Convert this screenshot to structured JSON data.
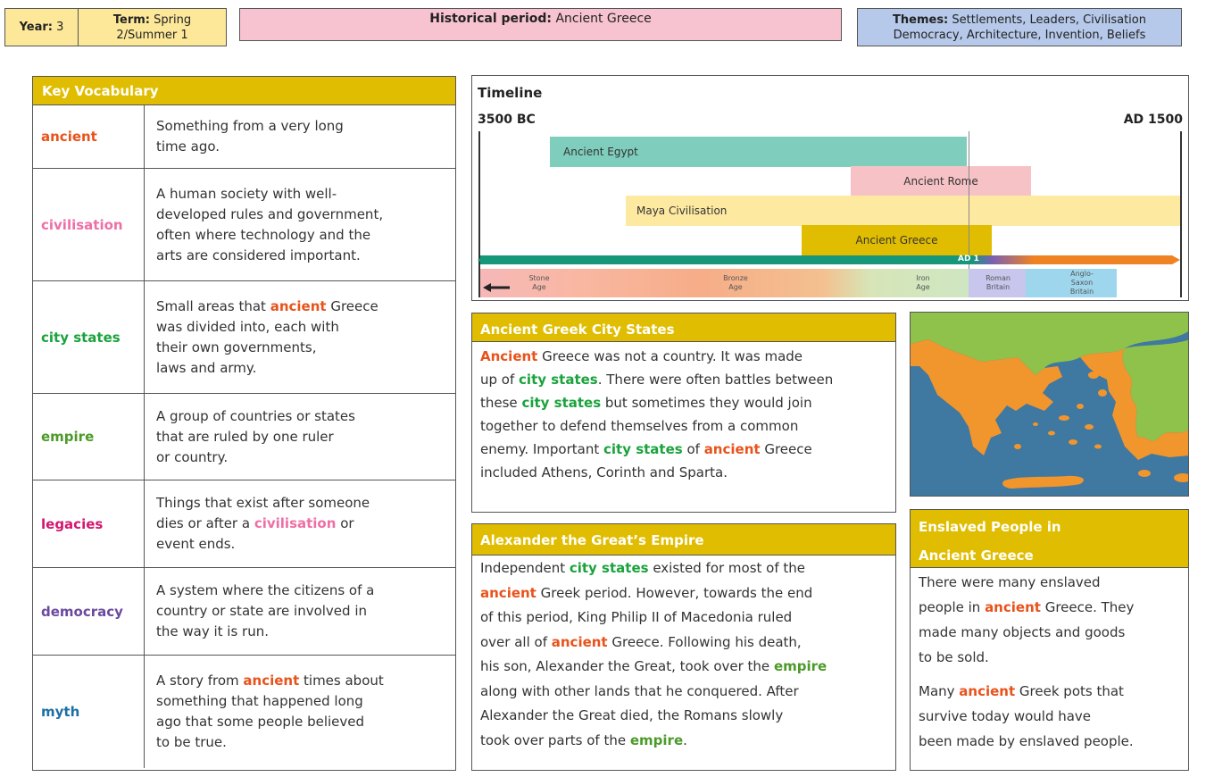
{
  "header": {
    "year_label": "Year:",
    "year_value": "3",
    "term_label": "Term:",
    "term_value_1": "Spring",
    "term_value_2": "2/Summer 1",
    "period_label": "Historical period:",
    "period_value": "Ancient Greece",
    "themes_label": "Themes:",
    "themes_line1": "Settlements, Leaders, Civilisation",
    "themes_line2": "Democracy, Architecture, Invention, Beliefs"
  },
  "vocab": {
    "title": "Key Vocabulary",
    "rows": [
      {
        "term": "ancient",
        "def": [
          "Something from a very long",
          "time ago."
        ]
      },
      {
        "term": "civilisation",
        "def": [
          "A human society with well-",
          "developed rules and government,",
          "often where technology and the",
          "arts are considered important."
        ]
      },
      {
        "term": "city states",
        "def_pre": "Small areas that ",
        "def_hl": "ancient",
        "def_post": " Greece",
        "def": [
          "was divided into, each with",
          "their own governments,",
          "laws and army."
        ]
      },
      {
        "term": "empire",
        "def": [
          "A group of countries or states",
          "that are ruled by one ruler",
          "or country."
        ]
      },
      {
        "term": "legacies",
        "def_l1": "Things that exist after someone",
        "def_l2_pre": "dies or after a ",
        "def_l2_hl": "civilisation",
        "def_l2_post": " or",
        "def_l3": "event ends."
      },
      {
        "term": "democracy",
        "def": [
          "A system where the citizens of a",
          "country or state are involved in",
          "the way it is run."
        ]
      },
      {
        "term": "myth",
        "def_pre": "A story from ",
        "def_hl": "ancient",
        "def_post": " times about",
        "def": [
          "something that happened long",
          "ago that some people believed",
          "to be true."
        ]
      }
    ]
  },
  "timeline": {
    "title": "Timeline",
    "start_label": "3500 BC",
    "end_label": "AD 1500",
    "ad_marker": "AD 1",
    "bars": [
      {
        "label": "Ancient Egypt",
        "color": "#7fcdbd"
      },
      {
        "label": "Ancient Rome",
        "color": "#f6c2c6"
      },
      {
        "label": "Maya Civilisation",
        "color": "#fdeaa0"
      },
      {
        "label": "Ancient Greece",
        "color": "#e0bd00"
      }
    ],
    "ages": [
      {
        "line1": "Stone",
        "line2": "Age",
        "line3": ""
      },
      {
        "line1": "Bronze",
        "line2": "Age",
        "line3": ""
      },
      {
        "line1": "Iron",
        "line2": "Age",
        "line3": ""
      },
      {
        "line1": "Roman",
        "line2": "Britain",
        "line3": ""
      },
      {
        "line1": "Anglo-",
        "line2": "Saxon",
        "line3": "Britain"
      }
    ]
  },
  "city_states": {
    "title": "Ancient Greek City States",
    "w": {
      "ancient": "Ancient",
      "ancient_lc": "ancient",
      "city_states": "city states"
    },
    "t1": " Greece was not a country. It was made",
    "t2": "up of ",
    "t3": ". There were often battles between",
    "t4": "these ",
    "t5": " but sometimes they would join",
    "t6": "together to defend themselves from a common",
    "t7": "enemy. Important ",
    "t8": " of ",
    "t9": " Greece",
    "t10": "included Athens, Corinth and Sparta."
  },
  "alexander": {
    "title": "Alexander the Great’s Empire",
    "w": {
      "city_states": "city states",
      "ancient": "ancient",
      "empire": "empire"
    },
    "t1": "Independent ",
    "t2": " existed for most of the",
    "t3": " Greek period. However, towards the end",
    "t4": "of this period, King Philip II of Macedonia ruled",
    "t5": "over all of ",
    "t6": " Greece. Following his death,",
    "t7": "his son, Alexander the Great, took over the ",
    "t8": "along with other lands that he conquered. After",
    "t9": "Alexander the Great died, the Romans slowly",
    "t10": "took over parts of the ",
    "t11": "."
  },
  "enslaved": {
    "title_line1": "Enslaved People in",
    "title_line2": "Ancient Greece",
    "w": {
      "ancient": "ancient"
    },
    "p1_l1": "There were many enslaved",
    "p1_l2_pre": "people in ",
    "p1_l2_post": " Greece. They",
    "p1_l3": "made many objects and goods",
    "p1_l4": "to be sold.",
    "p2_l1_pre": "Many ",
    "p2_l1_post": " Greek pots that",
    "p2_l2": "survive today would have",
    "p2_l3": "been made by enslaved people."
  },
  "map": {
    "icon": "greece-map-icon",
    "sea_color": "#3f78a0",
    "land_color": "#f1952d",
    "other_land_color": "#8fc24a"
  }
}
